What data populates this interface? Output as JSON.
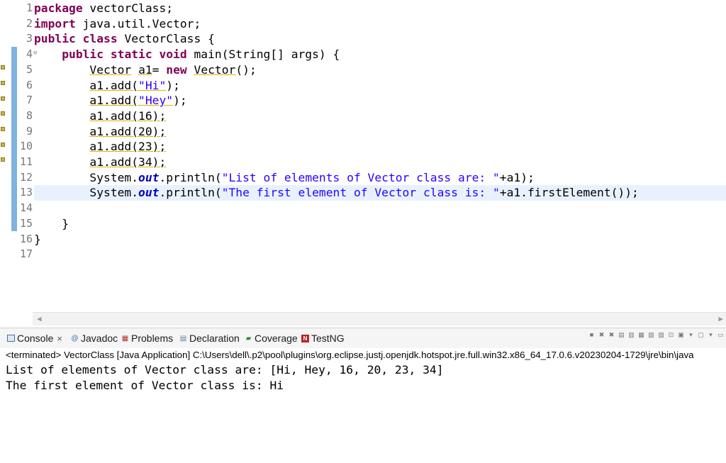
{
  "editor": {
    "line_numbers": [
      "1",
      "2",
      "3",
      "4",
      "5",
      "6",
      "7",
      "8",
      "9",
      "10",
      "11",
      "12",
      "13",
      "14",
      "15",
      "16",
      "17"
    ],
    "code": {
      "l1_kw": "package",
      "l1_rest": " vectorClass;",
      "l2_kw": "import",
      "l2_rest": " java.util.Vector;",
      "l3_kw": "public class",
      "l3_rest": " VectorClass {",
      "l4_indent": "    ",
      "l4_kw": "public static void",
      "l4_rest": " main(String[] args) {",
      "l5_indent": "        ",
      "l5_type": "Vector",
      "l5_mid": " ",
      "l5_var": "a1",
      "l5_eq": "= ",
      "l5_kw": "new",
      "l5_sp": " ",
      "l5_ctor": "Vector",
      "l5_end": "();",
      "l6_indent": "        ",
      "l6_call": "a1.add(",
      "l6_str": "\"Hi\"",
      "l6_end": ");",
      "l7_indent": "        ",
      "l7_call": "a1.add(",
      "l7_str": "\"Hey\"",
      "l7_end": ");",
      "l8_indent": "        ",
      "l8_call": "a1.add(16);",
      "l9_indent": "        ",
      "l9_call": "a1.add(20);",
      "l10_indent": "        ",
      "l10_call": "a1.add(23);",
      "l11_indent": "        ",
      "l11_call": "a1.add(34);",
      "l12_indent": "        ",
      "l12_a": "System.",
      "l12_fld": "out",
      "l12_b": ".println(",
      "l12_str": "\"List of elements of Vector class are: \"",
      "l12_end": "+a1);",
      "l13_indent": "        ",
      "l13_a": "System.",
      "l13_fld": "out",
      "l13_b": ".println(",
      "l13_str": "\"The first element of Vector class is: \"",
      "l13_end": "+a1.firstElement());",
      "l15": "    }",
      "l16": "}"
    }
  },
  "console": {
    "tabs": {
      "console": "Console",
      "javadoc": "Javadoc",
      "problems": "Problems",
      "declaration": "Declaration",
      "coverage": "Coverage",
      "testng": "TestNG"
    },
    "status": "<terminated> VectorClass [Java Application] C:\\Users\\dell\\.p2\\pool\\plugins\\org.eclipse.justj.openjdk.hotspot.jre.full.win32.x86_64_17.0.6.v20230204-1729\\jre\\bin\\java",
    "output": [
      "List of elements of Vector class are: [Hi, Hey, 16, 20, 23, 34]",
      "The first element of Vector class is: Hi"
    ]
  },
  "colors": {
    "keyword": "#7f0055",
    "string": "#2a00ff",
    "field": "#0000c0",
    "current_line": "#e8f2fe"
  }
}
